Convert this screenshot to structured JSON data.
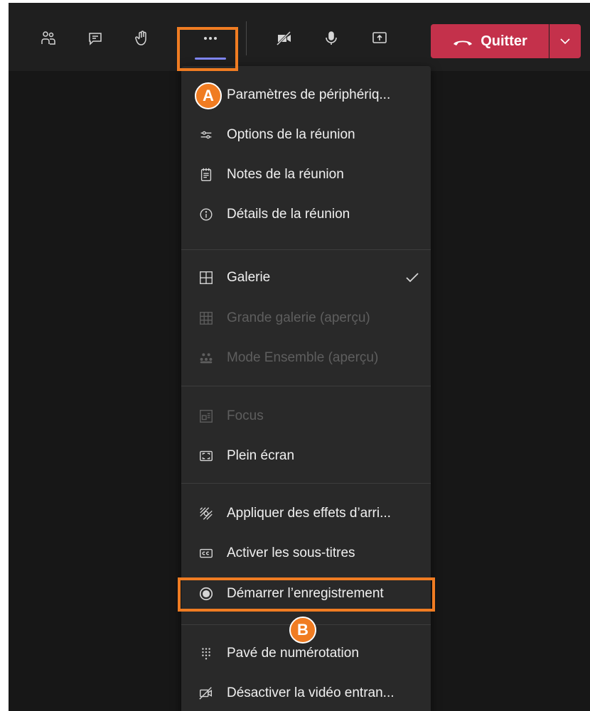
{
  "toolbar": {
    "icons": [
      "people-icon",
      "chat-icon",
      "raise-hand-icon",
      "more-options-icon",
      "camera-off-icon",
      "microphone-icon",
      "share-screen-icon"
    ],
    "leave_label": "Quitter"
  },
  "menu": {
    "sections": [
      [
        "Paramètres de périphériq...",
        "Options de la réunion",
        "Notes de la réunion",
        "Détails de la réunion"
      ],
      [
        "Galerie",
        "Grande galerie (aperçu)",
        "Mode Ensemble (aperçu)"
      ],
      [
        "Focus",
        "Plein écran"
      ],
      [
        "Appliquer des effets d’arri...",
        "Activer les sous-titres",
        "Démarrer l’enregistrement"
      ],
      [
        "Pavé de numérotation",
        "Désactiver la vidéo entran..."
      ]
    ]
  },
  "annotations": {
    "a": "A",
    "b": "B",
    "color": "#f07c22"
  },
  "colors": {
    "leave": "#c4314b",
    "accent": "#7f85f5",
    "menu_bg": "#292929",
    "toolbar_bg": "#1f1f1f"
  }
}
